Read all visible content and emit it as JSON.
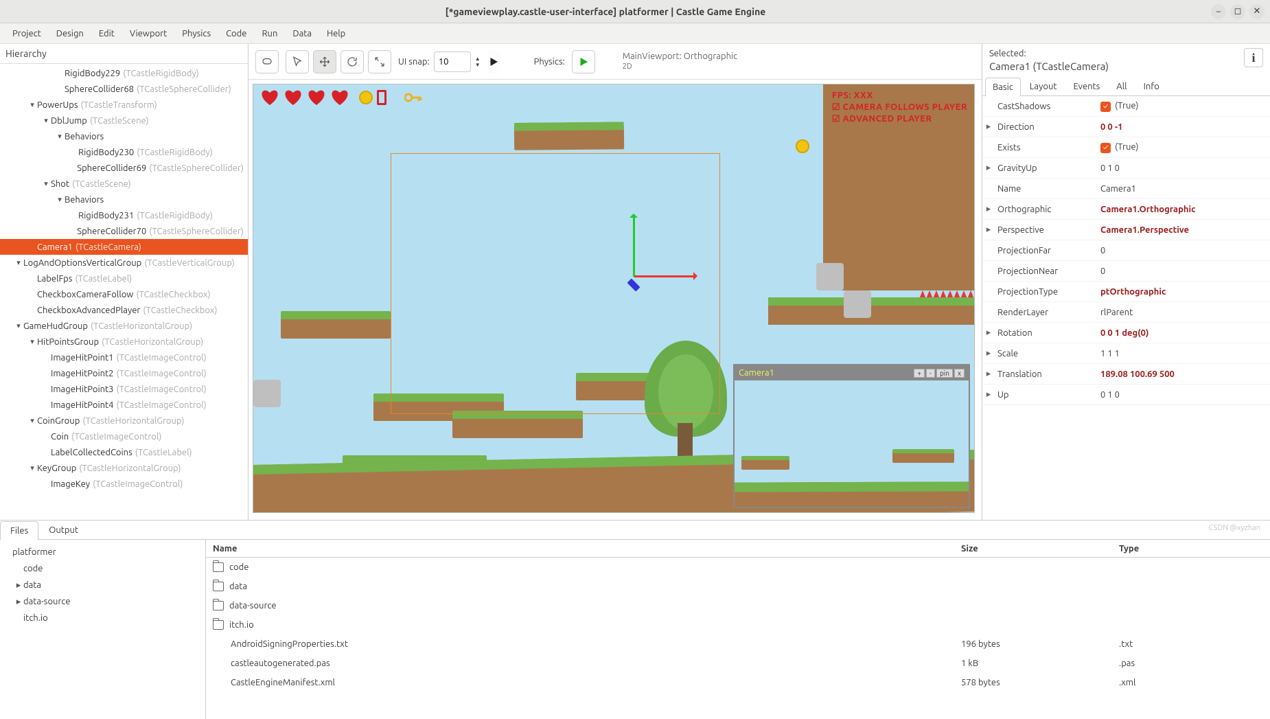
{
  "window": {
    "title": "[*gameviewplay.castle-user-interface] platformer | Castle Game Engine"
  },
  "menu": [
    "Project",
    "Design",
    "Edit",
    "Viewport",
    "Physics",
    "Code",
    "Run",
    "Data",
    "Help"
  ],
  "hierarchy": {
    "title": "Hierarchy",
    "items": [
      {
        "d": 4,
        "e": "",
        "n": "RigidBody229",
        "c": "(TCastleRigidBody)"
      },
      {
        "d": 4,
        "e": "",
        "n": "SphereCollider68",
        "c": "(TCastleSphereCollider)"
      },
      {
        "d": 2,
        "e": "▾",
        "n": "PowerUps",
        "c": "(TCastleTransform)"
      },
      {
        "d": 3,
        "e": "▾",
        "n": "DblJump",
        "c": "(TCastleScene)"
      },
      {
        "d": 4,
        "e": "▾",
        "n": "Behaviors",
        "c": ""
      },
      {
        "d": 5,
        "e": "",
        "n": "RigidBody230",
        "c": "(TCastleRigidBody)"
      },
      {
        "d": 5,
        "e": "",
        "n": "SphereCollider69",
        "c": "(TCastleSphereCollider)"
      },
      {
        "d": 3,
        "e": "▾",
        "n": "Shot",
        "c": "(TCastleScene)"
      },
      {
        "d": 4,
        "e": "▾",
        "n": "Behaviors",
        "c": ""
      },
      {
        "d": 5,
        "e": "",
        "n": "RigidBody231",
        "c": "(TCastleRigidBody)"
      },
      {
        "d": 5,
        "e": "",
        "n": "SphereCollider70",
        "c": "(TCastleSphereCollider)"
      },
      {
        "d": 2,
        "e": "",
        "n": "Camera1",
        "c": "(TCastleCamera)",
        "sel": true
      },
      {
        "d": 1,
        "e": "▾",
        "n": "LogAndOptionsVerticalGroup",
        "c": "(TCastleVerticalGroup)"
      },
      {
        "d": 2,
        "e": "",
        "n": "LabelFps",
        "c": "(TCastleLabel)"
      },
      {
        "d": 2,
        "e": "",
        "n": "CheckboxCameraFollow",
        "c": "(TCastleCheckbox)"
      },
      {
        "d": 2,
        "e": "",
        "n": "CheckboxAdvancedPlayer",
        "c": "(TCastleCheckbox)"
      },
      {
        "d": 1,
        "e": "▾",
        "n": "GameHudGroup",
        "c": "(TCastleHorizontalGroup)"
      },
      {
        "d": 2,
        "e": "▾",
        "n": "HitPointsGroup",
        "c": "(TCastleHorizontalGroup)"
      },
      {
        "d": 3,
        "e": "",
        "n": "ImageHitPoint1",
        "c": "(TCastleImageControl)"
      },
      {
        "d": 3,
        "e": "",
        "n": "ImageHitPoint2",
        "c": "(TCastleImageControl)"
      },
      {
        "d": 3,
        "e": "",
        "n": "ImageHitPoint3",
        "c": "(TCastleImageControl)"
      },
      {
        "d": 3,
        "e": "",
        "n": "ImageHitPoint4",
        "c": "(TCastleImageControl)"
      },
      {
        "d": 2,
        "e": "▾",
        "n": "CoinGroup",
        "c": "(TCastleHorizontalGroup)"
      },
      {
        "d": 3,
        "e": "",
        "n": "Coin",
        "c": "(TCastleImageControl)"
      },
      {
        "d": 3,
        "e": "",
        "n": "LabelCollectedCoins",
        "c": "(TCastleLabel)"
      },
      {
        "d": 2,
        "e": "▾",
        "n": "KeyGroup",
        "c": "(TCastleHorizontalGroup)"
      },
      {
        "d": 3,
        "e": "",
        "n": "ImageKey",
        "c": "(TCastleImageControl)"
      }
    ]
  },
  "toolbar": {
    "uisnap_label": "UI snap:",
    "uisnap_value": "10",
    "physics_label": "Physics:",
    "viewport_line1": "MainViewport: Orthographic",
    "viewport_line2": "2D"
  },
  "camera_preview": {
    "title": "Camera1",
    "btn_plus": "+",
    "btn_minus": "-",
    "btn_pin": "pin",
    "btn_close": "x"
  },
  "hud": {
    "fps": "FPS: XXX",
    "opt1": "CAMERA FOLLOWS PLAYER",
    "opt2": "ADVANCED PLAYER"
  },
  "inspector": {
    "selected_label": "Selected:",
    "selected_name": "Camera1 (TCastleCamera)",
    "tabs": [
      "Basic",
      "Layout",
      "Events",
      "All",
      "Info"
    ],
    "props": [
      {
        "exp": "",
        "k": "CastShadows",
        "v": "(True)",
        "chk": true
      },
      {
        "exp": "▸",
        "k": "Direction",
        "v": "0 0 -1",
        "bold": true
      },
      {
        "exp": "",
        "k": "Exists",
        "v": "(True)",
        "chk": true
      },
      {
        "exp": "▸",
        "k": "GravityUp",
        "v": "0 1 0"
      },
      {
        "exp": "",
        "k": "Name",
        "v": "Camera1"
      },
      {
        "exp": "▸",
        "k": "Orthographic",
        "v": "Camera1.Orthographic",
        "bold": true
      },
      {
        "exp": "▸",
        "k": "Perspective",
        "v": "Camera1.Perspective",
        "bold": true
      },
      {
        "exp": "",
        "k": "ProjectionFar",
        "v": "0"
      },
      {
        "exp": "",
        "k": "ProjectionNear",
        "v": "0"
      },
      {
        "exp": "",
        "k": "ProjectionType",
        "v": "ptOrthographic",
        "bold": true
      },
      {
        "exp": "",
        "k": "RenderLayer",
        "v": "rlParent"
      },
      {
        "exp": "▸",
        "k": "Rotation",
        "v": "0 0 1 deg(0)",
        "bold": true
      },
      {
        "exp": "▸",
        "k": "Scale",
        "v": "1 1 1"
      },
      {
        "exp": "▸",
        "k": "Translation",
        "v": "189.08 100.69 500",
        "bold": true
      },
      {
        "exp": "▸",
        "k": "Up",
        "v": "0 1 0"
      }
    ]
  },
  "bottom": {
    "tabs": [
      "Files",
      "Output"
    ],
    "tree": [
      {
        "d": 0,
        "e": "",
        "n": "platformer"
      },
      {
        "d": 1,
        "e": "",
        "n": "code"
      },
      {
        "d": 1,
        "e": "▸",
        "n": "data"
      },
      {
        "d": 1,
        "e": "▸",
        "n": "data-source"
      },
      {
        "d": 1,
        "e": "",
        "n": "itch.io"
      }
    ],
    "headers": {
      "name": "Name",
      "size": "Size",
      "type": "Type"
    },
    "rows": [
      {
        "icon": "folder",
        "name": "code",
        "size": "",
        "type": ""
      },
      {
        "icon": "folder",
        "name": "data",
        "size": "",
        "type": ""
      },
      {
        "icon": "folder",
        "name": "data-source",
        "size": "",
        "type": ""
      },
      {
        "icon": "folder",
        "name": "itch.io",
        "size": "",
        "type": ""
      },
      {
        "icon": "",
        "name": "AndroidSigningProperties.txt",
        "size": "196 bytes",
        "type": ".txt"
      },
      {
        "icon": "",
        "name": "castleautogenerated.pas",
        "size": "1 kB",
        "type": ".pas"
      },
      {
        "icon": "",
        "name": "CastleEngineManifest.xml",
        "size": "578 bytes",
        "type": ".xml"
      }
    ]
  },
  "watermark": "CSDN @xyzhan"
}
